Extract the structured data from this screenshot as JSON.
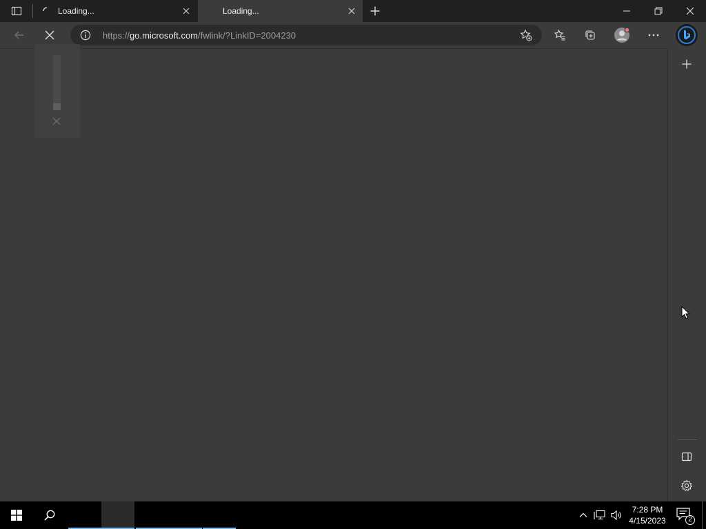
{
  "browser": {
    "tabs": [
      {
        "title": "Loading...",
        "loading": true,
        "active": false
      },
      {
        "title": "Loading...",
        "loading": false,
        "active": true
      }
    ],
    "address": {
      "scheme_prefix": "https://",
      "host": "go.microsoft.com",
      "path": "/fwlink/?LinkID=2004230"
    }
  },
  "icons": {
    "tab_actions": "tab-actions-icon",
    "new_tab": "plus-icon",
    "minimize": "minimize-icon",
    "restore": "restore-icon",
    "close": "close-icon",
    "back": "back-arrow-icon",
    "stop": "stop-icon",
    "site_info": "info-icon",
    "add_favorite": "star-plus-icon",
    "favorites": "favorites-icon",
    "collections": "collections-icon",
    "profile": "profile-icon",
    "more": "more-icon",
    "bing": "bing-icon",
    "sidebar_add": "plus-icon",
    "sidebar_hide": "sidebar-icon",
    "settings": "gear-icon"
  },
  "loading_widget": {
    "progress": 0.12
  },
  "taskbar": {
    "time": "7:28 PM",
    "date": "4/15/2023",
    "notification_count": "2"
  },
  "colors": {
    "accent_blue": "#76b9ed",
    "chrome_dark": "#202020",
    "page_gray": "#3b3b3b",
    "notification_red": "#f1707b"
  }
}
